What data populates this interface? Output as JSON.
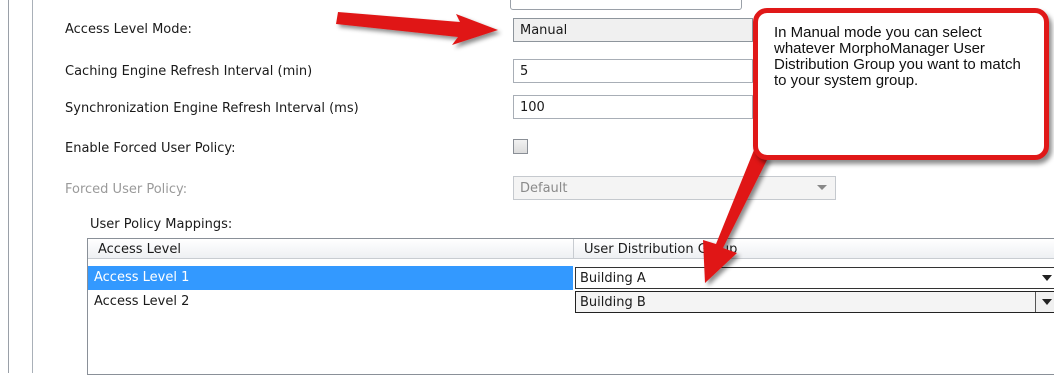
{
  "settings": {
    "access_level_mode": {
      "label": "Access Level Mode:",
      "value": "Manual"
    },
    "caching_refresh": {
      "label": "Caching Engine Refresh Interval (min)",
      "value": "5"
    },
    "sync_refresh": {
      "label": "Synchronization Engine Refresh Interval (ms)",
      "value": "100"
    },
    "enable_forced_policy": {
      "label": "Enable Forced User Policy:",
      "checked": false
    },
    "forced_policy": {
      "label": "Forced User Policy:",
      "value": "Default",
      "disabled": true
    }
  },
  "mappings": {
    "title": "User Policy Mappings:",
    "columns": [
      "Access Level",
      "User Distribution Group"
    ],
    "rows": [
      {
        "access_level": "Access Level 1",
        "group": "Building A",
        "selected": true
      },
      {
        "access_level": "Access Level 2",
        "group": "Building B",
        "selected": false
      }
    ]
  },
  "callout": {
    "text": "In Manual mode you can select whatever MorphoManager User Distribution Group you want to match to your system group.",
    "border_color": "#e01818"
  },
  "colors": {
    "selection": "#3399ff",
    "annotation_red": "#e01818"
  }
}
